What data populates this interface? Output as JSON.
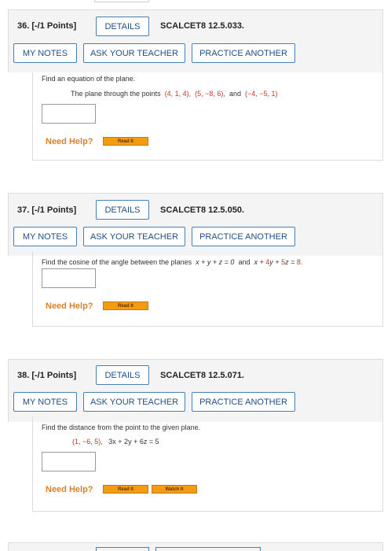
{
  "common": {
    "details_label": "DETAILS",
    "my_notes_label": "MY NOTES",
    "ask_teacher_label": "ASK YOUR TEACHER",
    "practice_label": "PRACTICE ANOTHER",
    "need_help_label": "Need Help?",
    "read_it_label": "Read It",
    "watch_it_label": "Watch It"
  },
  "questions": [
    {
      "number": "36.",
      "points": "[-/1 Points]",
      "code": "SCALCET8 12.5.033.",
      "prompt": "Find an equation of the plane.",
      "line2_pre": "The plane through the points",
      "p1": "(4, 1, 4),",
      "p2": "(5, −8, 6),",
      "and": "and",
      "p3": "(−4, −5, 1)"
    },
    {
      "number": "37.",
      "points": "[-/1 Points]",
      "code": "SCALCET8 12.5.050.",
      "prompt_pre": "Find the cosine of the angle between the planes",
      "eq1": "x + y + z = 0",
      "and": "and",
      "eq2_pre": "x +",
      "eq2_4": "4",
      "eq2_mid": "y +",
      "eq2_5": "5",
      "eq2_z": "z =",
      "eq2_8": "8."
    },
    {
      "number": "38.",
      "points": "[-/1 Points]",
      "code": "SCALCET8 12.5.071.",
      "prompt": "Find the distance from the point to the given plane.",
      "point": "(1, −6, 5),",
      "plane": "3x + 2y + 6z = 5"
    }
  ]
}
